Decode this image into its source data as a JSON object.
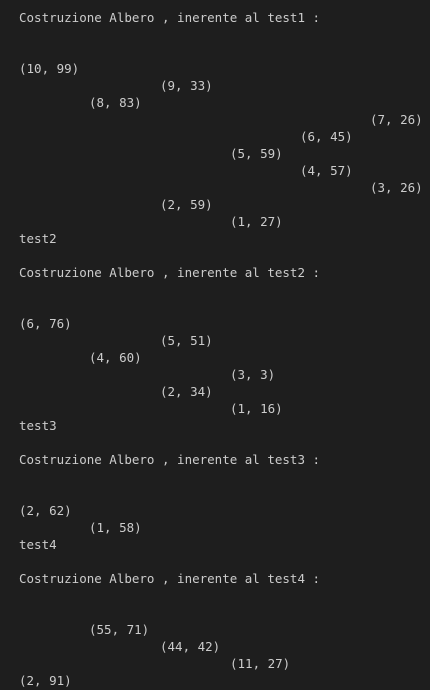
{
  "lines": [
    {
      "text": "Costruzione Albero , inerente al test1 :"
    },
    {
      "text": "(10, 99)"
    },
    {
      "text": "(9, 33)"
    },
    {
      "text": "(8, 83)"
    },
    {
      "text": "(7, 26)"
    },
    {
      "text": "(6, 45)"
    },
    {
      "text": "(5, 59)"
    },
    {
      "text": "(4, 57)"
    },
    {
      "text": "(3, 26)"
    },
    {
      "text": "(2, 59)"
    },
    {
      "text": "(1, 27)"
    },
    {
      "text": "test2"
    },
    {
      "text": "Costruzione Albero , inerente al test2 :"
    },
    {
      "text": "(6, 76)"
    },
    {
      "text": "(5, 51)"
    },
    {
      "text": "(4, 60)"
    },
    {
      "text": "(3, 3)"
    },
    {
      "text": "(2, 34)"
    },
    {
      "text": "(1, 16)"
    },
    {
      "text": "test3"
    },
    {
      "text": "Costruzione Albero , inerente al test3 :"
    },
    {
      "text": "(2, 62)"
    },
    {
      "text": "(1, 58)"
    },
    {
      "text": "test4"
    },
    {
      "text": "Costruzione Albero , inerente al test4 :"
    },
    {
      "text": "(55, 71)"
    },
    {
      "text": "(44, 42)"
    },
    {
      "text": "(11, 27)"
    },
    {
      "text": "(2, 91)"
    }
  ]
}
